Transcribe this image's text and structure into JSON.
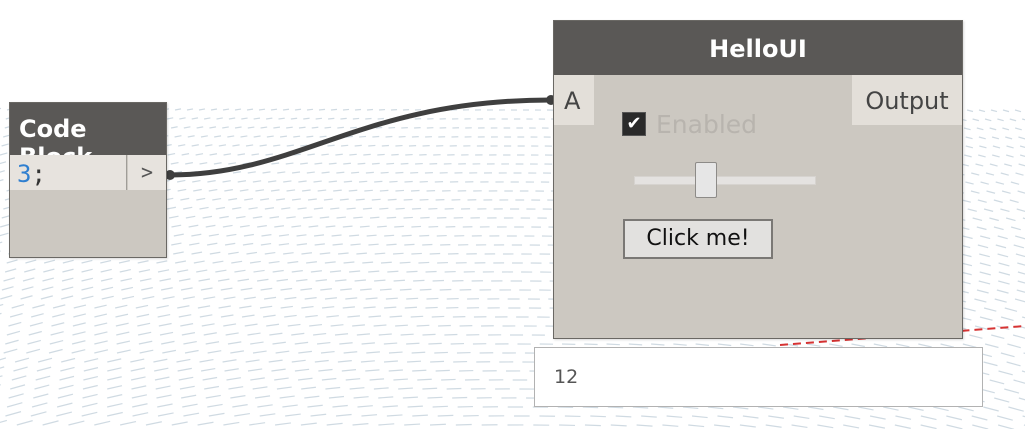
{
  "code_block": {
    "title": "Code Block",
    "code_number": "3",
    "code_terminator": ";",
    "output_port": ">"
  },
  "hello_ui": {
    "title": "HelloUI",
    "input_port": "A",
    "output_port": "Output",
    "checkbox_label": "Enabled",
    "checkbox_checked": true,
    "button_label": "Click me!",
    "slider_value_fraction": 0.4
  },
  "preview": {
    "value": "12"
  },
  "colors": {
    "node_header": "#5a5856",
    "node_body": "#ccc8c1",
    "wire": "#3f3f3f",
    "grid": "#9fb4c4",
    "code_number": "#2f7fd0"
  },
  "icons": {
    "checkbox": "checkmark-icon"
  }
}
